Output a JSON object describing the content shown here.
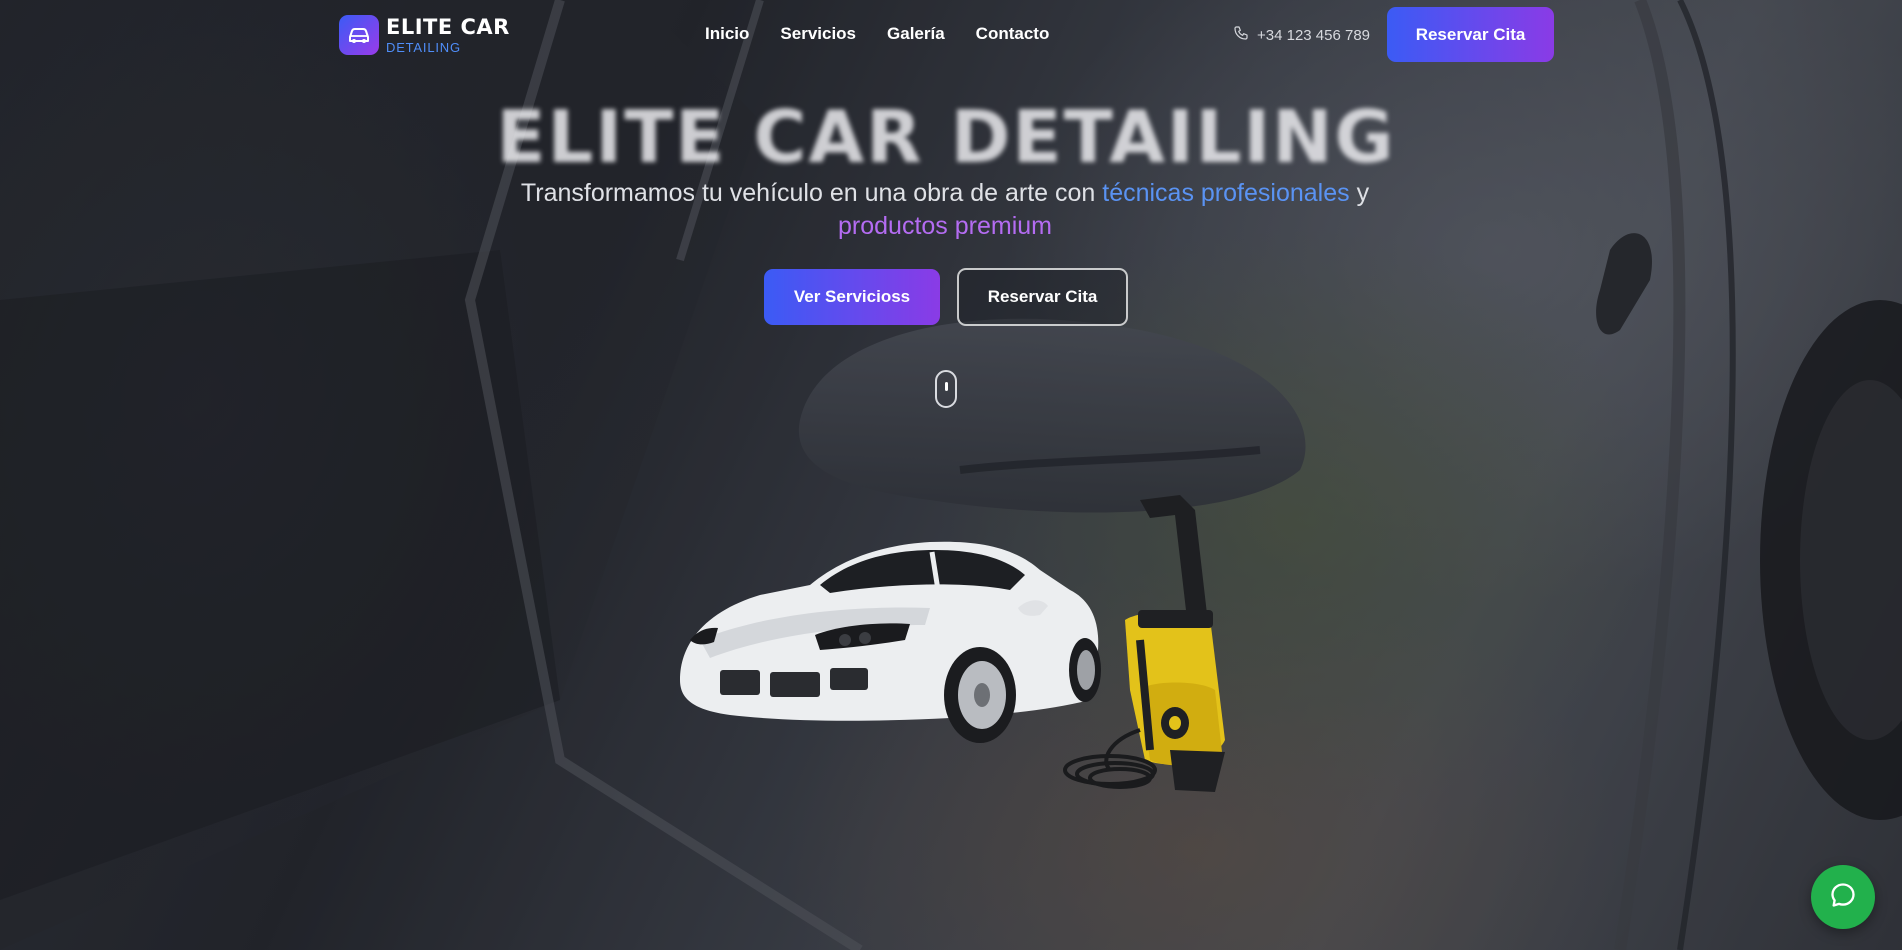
{
  "brand": {
    "title": "ELITE CAR",
    "subtitle": "DETAILING",
    "icon": "car-icon",
    "gradient_start": "#3b5bf5",
    "gradient_end": "#9a3bea"
  },
  "nav": {
    "items": [
      {
        "label": "Inicio"
      },
      {
        "label": "Servicios"
      },
      {
        "label": "Galería"
      },
      {
        "label": "Contacto"
      }
    ]
  },
  "header": {
    "phone_icon": "phone-icon",
    "phone": "+34 123 456 789",
    "cta_label": "Reservar Cita"
  },
  "hero": {
    "title": "ELITE CAR DETAILING",
    "subtitle_part1": "Transformamos tu vehículo en una obra de arte con ",
    "subtitle_highlight1": "técnicas profesionales",
    "subtitle_part2": " y ",
    "subtitle_highlight2": "productos premium",
    "primary_button": "Ver Servicioss",
    "secondary_button": "Reservar Cita",
    "highlight_blue": "#5a93f3",
    "highlight_purple": "#b46cf2"
  },
  "floating": {
    "chat_icon": "whatsapp-icon",
    "color": "#22b14c"
  }
}
